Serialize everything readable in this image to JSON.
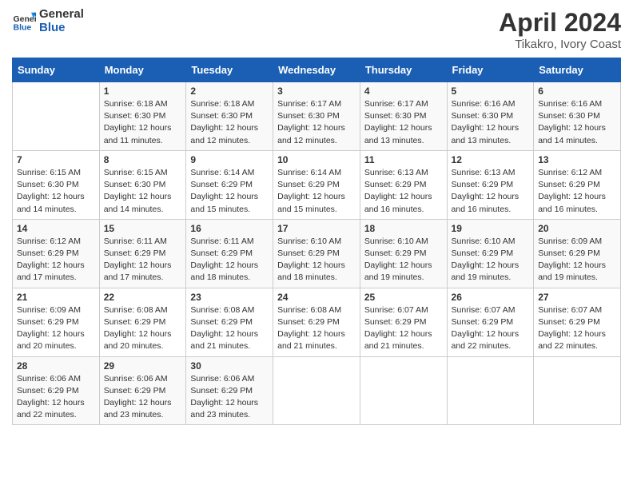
{
  "logo": {
    "line1": "General",
    "line2": "Blue"
  },
  "title": "April 2024",
  "subtitle": "Tikakro, Ivory Coast",
  "days_of_week": [
    "Sunday",
    "Monday",
    "Tuesday",
    "Wednesday",
    "Thursday",
    "Friday",
    "Saturday"
  ],
  "weeks": [
    [
      {
        "num": "",
        "info": ""
      },
      {
        "num": "1",
        "info": "Sunrise: 6:18 AM\nSunset: 6:30 PM\nDaylight: 12 hours\nand 11 minutes."
      },
      {
        "num": "2",
        "info": "Sunrise: 6:18 AM\nSunset: 6:30 PM\nDaylight: 12 hours\nand 12 minutes."
      },
      {
        "num": "3",
        "info": "Sunrise: 6:17 AM\nSunset: 6:30 PM\nDaylight: 12 hours\nand 12 minutes."
      },
      {
        "num": "4",
        "info": "Sunrise: 6:17 AM\nSunset: 6:30 PM\nDaylight: 12 hours\nand 13 minutes."
      },
      {
        "num": "5",
        "info": "Sunrise: 6:16 AM\nSunset: 6:30 PM\nDaylight: 12 hours\nand 13 minutes."
      },
      {
        "num": "6",
        "info": "Sunrise: 6:16 AM\nSunset: 6:30 PM\nDaylight: 12 hours\nand 14 minutes."
      }
    ],
    [
      {
        "num": "7",
        "info": "Sunrise: 6:15 AM\nSunset: 6:30 PM\nDaylight: 12 hours\nand 14 minutes."
      },
      {
        "num": "8",
        "info": "Sunrise: 6:15 AM\nSunset: 6:30 PM\nDaylight: 12 hours\nand 14 minutes."
      },
      {
        "num": "9",
        "info": "Sunrise: 6:14 AM\nSunset: 6:29 PM\nDaylight: 12 hours\nand 15 minutes."
      },
      {
        "num": "10",
        "info": "Sunrise: 6:14 AM\nSunset: 6:29 PM\nDaylight: 12 hours\nand 15 minutes."
      },
      {
        "num": "11",
        "info": "Sunrise: 6:13 AM\nSunset: 6:29 PM\nDaylight: 12 hours\nand 16 minutes."
      },
      {
        "num": "12",
        "info": "Sunrise: 6:13 AM\nSunset: 6:29 PM\nDaylight: 12 hours\nand 16 minutes."
      },
      {
        "num": "13",
        "info": "Sunrise: 6:12 AM\nSunset: 6:29 PM\nDaylight: 12 hours\nand 16 minutes."
      }
    ],
    [
      {
        "num": "14",
        "info": "Sunrise: 6:12 AM\nSunset: 6:29 PM\nDaylight: 12 hours\nand 17 minutes."
      },
      {
        "num": "15",
        "info": "Sunrise: 6:11 AM\nSunset: 6:29 PM\nDaylight: 12 hours\nand 17 minutes."
      },
      {
        "num": "16",
        "info": "Sunrise: 6:11 AM\nSunset: 6:29 PM\nDaylight: 12 hours\nand 18 minutes."
      },
      {
        "num": "17",
        "info": "Sunrise: 6:10 AM\nSunset: 6:29 PM\nDaylight: 12 hours\nand 18 minutes."
      },
      {
        "num": "18",
        "info": "Sunrise: 6:10 AM\nSunset: 6:29 PM\nDaylight: 12 hours\nand 19 minutes."
      },
      {
        "num": "19",
        "info": "Sunrise: 6:10 AM\nSunset: 6:29 PM\nDaylight: 12 hours\nand 19 minutes."
      },
      {
        "num": "20",
        "info": "Sunrise: 6:09 AM\nSunset: 6:29 PM\nDaylight: 12 hours\nand 19 minutes."
      }
    ],
    [
      {
        "num": "21",
        "info": "Sunrise: 6:09 AM\nSunset: 6:29 PM\nDaylight: 12 hours\nand 20 minutes."
      },
      {
        "num": "22",
        "info": "Sunrise: 6:08 AM\nSunset: 6:29 PM\nDaylight: 12 hours\nand 20 minutes."
      },
      {
        "num": "23",
        "info": "Sunrise: 6:08 AM\nSunset: 6:29 PM\nDaylight: 12 hours\nand 21 minutes."
      },
      {
        "num": "24",
        "info": "Sunrise: 6:08 AM\nSunset: 6:29 PM\nDaylight: 12 hours\nand 21 minutes."
      },
      {
        "num": "25",
        "info": "Sunrise: 6:07 AM\nSunset: 6:29 PM\nDaylight: 12 hours\nand 21 minutes."
      },
      {
        "num": "26",
        "info": "Sunrise: 6:07 AM\nSunset: 6:29 PM\nDaylight: 12 hours\nand 22 minutes."
      },
      {
        "num": "27",
        "info": "Sunrise: 6:07 AM\nSunset: 6:29 PM\nDaylight: 12 hours\nand 22 minutes."
      }
    ],
    [
      {
        "num": "28",
        "info": "Sunrise: 6:06 AM\nSunset: 6:29 PM\nDaylight: 12 hours\nand 22 minutes."
      },
      {
        "num": "29",
        "info": "Sunrise: 6:06 AM\nSunset: 6:29 PM\nDaylight: 12 hours\nand 23 minutes."
      },
      {
        "num": "30",
        "info": "Sunrise: 6:06 AM\nSunset: 6:29 PM\nDaylight: 12 hours\nand 23 minutes."
      },
      {
        "num": "",
        "info": ""
      },
      {
        "num": "",
        "info": ""
      },
      {
        "num": "",
        "info": ""
      },
      {
        "num": "",
        "info": ""
      }
    ]
  ]
}
